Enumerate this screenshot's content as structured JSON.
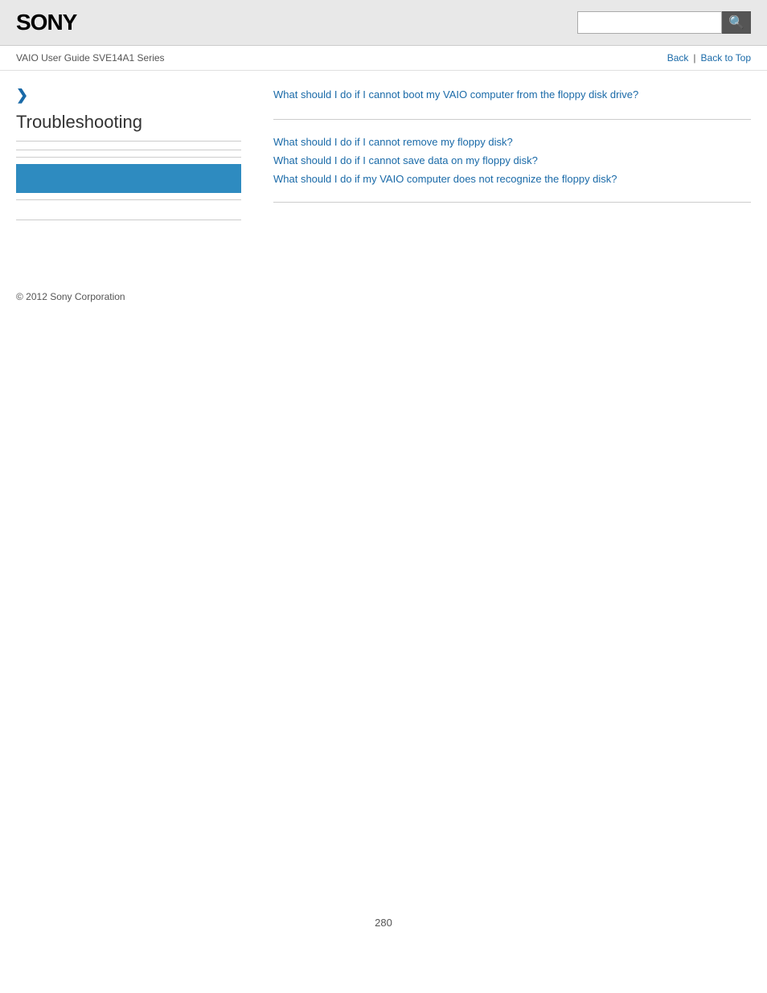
{
  "header": {
    "logo": "SONY",
    "search_placeholder": ""
  },
  "breadcrumb": {
    "guide_text": "VAIO User Guide SVE14A1 Series",
    "back_label": "Back",
    "separator": "|",
    "back_to_top_label": "Back to Top"
  },
  "sidebar": {
    "chevron": "❯",
    "title": "Troubleshooting"
  },
  "content": {
    "primary_link": "What should I do if I cannot boot my VAIO computer from the floppy disk drive?",
    "secondary_links": [
      "What should I do if I cannot remove my floppy disk?",
      "What should I do if I cannot save data on my floppy disk?",
      "What should I do if my VAIO computer does not recognize the floppy disk?"
    ]
  },
  "footer": {
    "copyright": "© 2012 Sony Corporation"
  },
  "page_number": "280",
  "icons": {
    "search": "🔍"
  }
}
